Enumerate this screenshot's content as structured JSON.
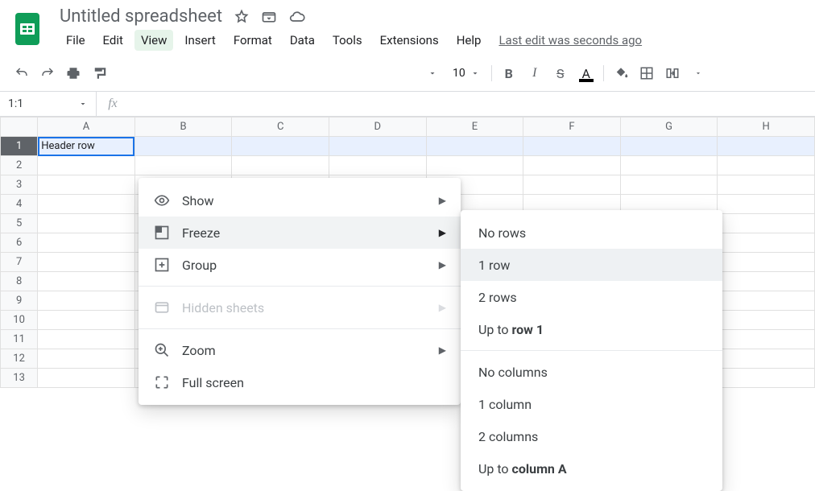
{
  "header": {
    "doc_title": "Untitled spreadsheet",
    "last_edit": "Last edit was seconds ago"
  },
  "menubar": [
    "File",
    "Edit",
    "View",
    "Insert",
    "Format",
    "Data",
    "Tools",
    "Extensions",
    "Help"
  ],
  "menubar_active": "View",
  "toolbar": {
    "font_size": "10"
  },
  "name_box": "1:1",
  "view_menu": {
    "items": [
      {
        "label": "Show",
        "icon": "eye",
        "submenu": true
      },
      {
        "label": "Freeze",
        "icon": "freeze",
        "submenu": true,
        "hover": true
      },
      {
        "label": "Group",
        "icon": "group",
        "submenu": true
      },
      {
        "sep": true
      },
      {
        "label": "Hidden sheets",
        "icon": "hidden",
        "submenu": true,
        "disabled": true
      },
      {
        "sep": true
      },
      {
        "label": "Zoom",
        "icon": "zoom",
        "submenu": true
      },
      {
        "label": "Full screen",
        "icon": "fullscreen"
      }
    ]
  },
  "freeze_menu": {
    "items": [
      {
        "label": "No rows"
      },
      {
        "label": "1 row",
        "highlight": true
      },
      {
        "label": "2 rows"
      },
      {
        "label_html": "Up to <b>row 1</b>"
      },
      {
        "sep": true
      },
      {
        "label": "No columns"
      },
      {
        "label": "1 column"
      },
      {
        "label": "2 columns"
      },
      {
        "label_html": "Up to <b>column A</b>"
      }
    ]
  },
  "grid": {
    "columns": [
      "A",
      "B",
      "C",
      "D",
      "E",
      "F",
      "G",
      "H"
    ],
    "rows": 13,
    "selected_row": 1,
    "cells": {
      "A1": "Header row"
    }
  }
}
